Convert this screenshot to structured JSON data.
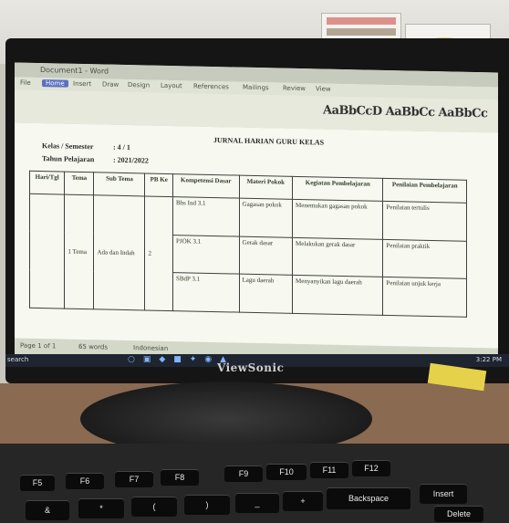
{
  "monitor": {
    "brand": "ViewSonic"
  },
  "app": {
    "title": "Document1 - Word",
    "tabs": [
      "File",
      "Home",
      "Insert",
      "Draw",
      "Design",
      "Layout",
      "References",
      "Mailings",
      "Review",
      "View"
    ],
    "active_tab": "Home",
    "styles_preview": "AaBbCcD AaBbCc AaBbCc"
  },
  "doc": {
    "kelas_label": "Kelas / Semester",
    "kelas_value": ": 4 / 1",
    "tahun_label": "Tahun Pelajaran",
    "tahun_value": ": 2021/2022",
    "title": "JURNAL HARIAN GURU KELAS"
  },
  "table": {
    "headers": [
      "Hari/Tgl",
      "Tema",
      "Sub Tema",
      "PB Ke",
      "Kompetensi Dasar",
      "Materi Pokok",
      "Kegiatan Pembelajaran",
      "Penilaian Pembelajaran"
    ],
    "tema": "1 Tema",
    "sub_tema": "Ada dan Indah",
    "pb": "2",
    "rows": [
      {
        "kd": "Bhs Ind 3.1",
        "materi": "Gagasan pokok",
        "kegiatan": "Menemukan gagasan pokok",
        "penilaian": "Penilaian tertulis"
      },
      {
        "kd": "PJOK 3.1",
        "materi": "Gerak dasar",
        "kegiatan": "Melakukan gerak dasar",
        "penilaian": "Penilaian praktik"
      },
      {
        "kd": "SBdP 3.1",
        "materi": "Lagu daerah",
        "kegiatan": "Menyanyikan lagu daerah",
        "penilaian": "Penilaian unjuk kerja"
      }
    ]
  },
  "statusbar": {
    "page": "Page 1 of 1",
    "words": "65 words",
    "language": "Indonesian"
  },
  "taskbar": {
    "search": "search",
    "tray_time": "3:22 PM"
  },
  "keyboard": {
    "function_keys": [
      "F5",
      "F6",
      "F7",
      "F8",
      "F9",
      "F10",
      "F11",
      "F12"
    ],
    "number_keys": [
      "&",
      "*",
      "(",
      ")",
      "_",
      "+"
    ],
    "backspace": "Backspace",
    "insert": "Insert",
    "delete": "Delete"
  }
}
